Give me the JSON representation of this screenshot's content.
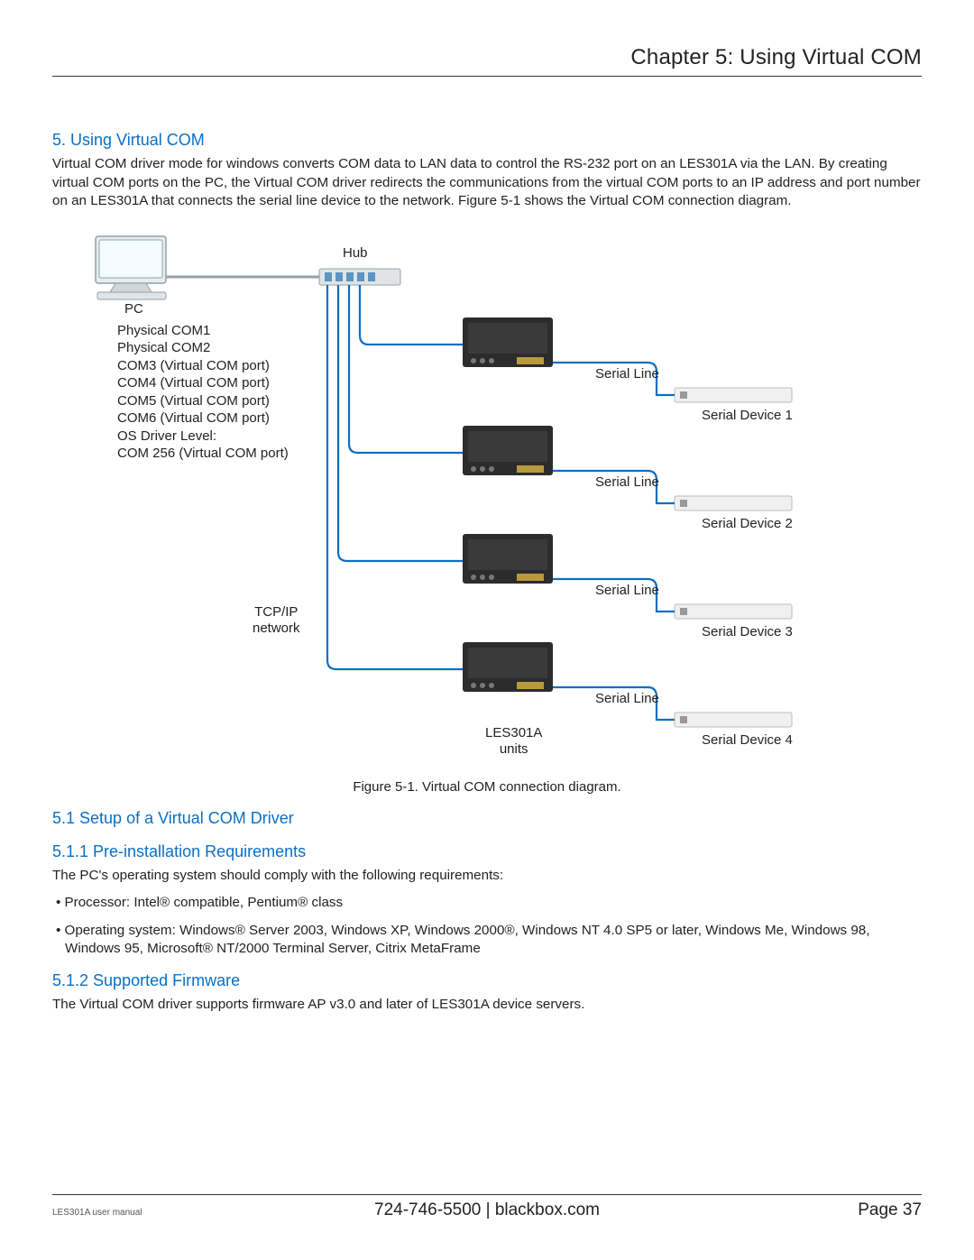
{
  "header": "Chapter 5: Using Virtual COM",
  "section5": {
    "title": "5. Using Virtual COM",
    "body": "Virtual COM driver mode for windows converts COM data to LAN data to control the RS-232 port on an LES301A via the LAN. By creating virtual COM ports on the PC, the Virtual COM driver redirects the communications from the virtual COM ports to an IP address and port number on an LES301A that connects the serial line device to the network. Figure 5-1 shows the Virtual COM connection diagram."
  },
  "diagram": {
    "pc": "PC",
    "hub": "Hub",
    "com_list": [
      "Physical COM1",
      "Physical COM2",
      "COM3 (Virtual COM port)",
      "COM4 (Virtual COM port)",
      "COM5 (Virtual COM port)",
      "COM6 (Virtual COM port)",
      "OS Driver Level:",
      "COM 256 (Virtual COM port)"
    ],
    "tcpip": "TCP/IP\nnetwork",
    "serial_line": "Serial Line",
    "devices": [
      "Serial Device 1",
      "Serial Device 2",
      "Serial Device 3",
      "Serial Device 4"
    ],
    "units": "LES301A\nunits"
  },
  "figure_caption": "Figure 5-1. Virtual COM connection diagram.",
  "section51": {
    "title": "5.1 Setup of a Virtual COM Driver"
  },
  "section511": {
    "title": "5.1.1 Pre-installation Requirements",
    "intro": "The PC's operating system should comply with the following requirements:",
    "bullets": [
      "Processor: Intel® compatible, Pentium® class",
      "Operating system: Windows® Server 2003, Windows XP, Windows 2000®, Windows NT 4.0 SP5 or later, Windows Me, Windows 98, Windows 95, Microsoft® NT/2000 Terminal Server, Citrix MetaFrame"
    ]
  },
  "section512": {
    "title": "5.1.2 Supported Firmware",
    "body": "The Virtual COM driver supports firmware AP v3.0 and later of LES301A device servers."
  },
  "footer": {
    "left": "LES301A user manual",
    "center": "724-746-5500   |   blackbox.com",
    "right": "Page 37"
  }
}
